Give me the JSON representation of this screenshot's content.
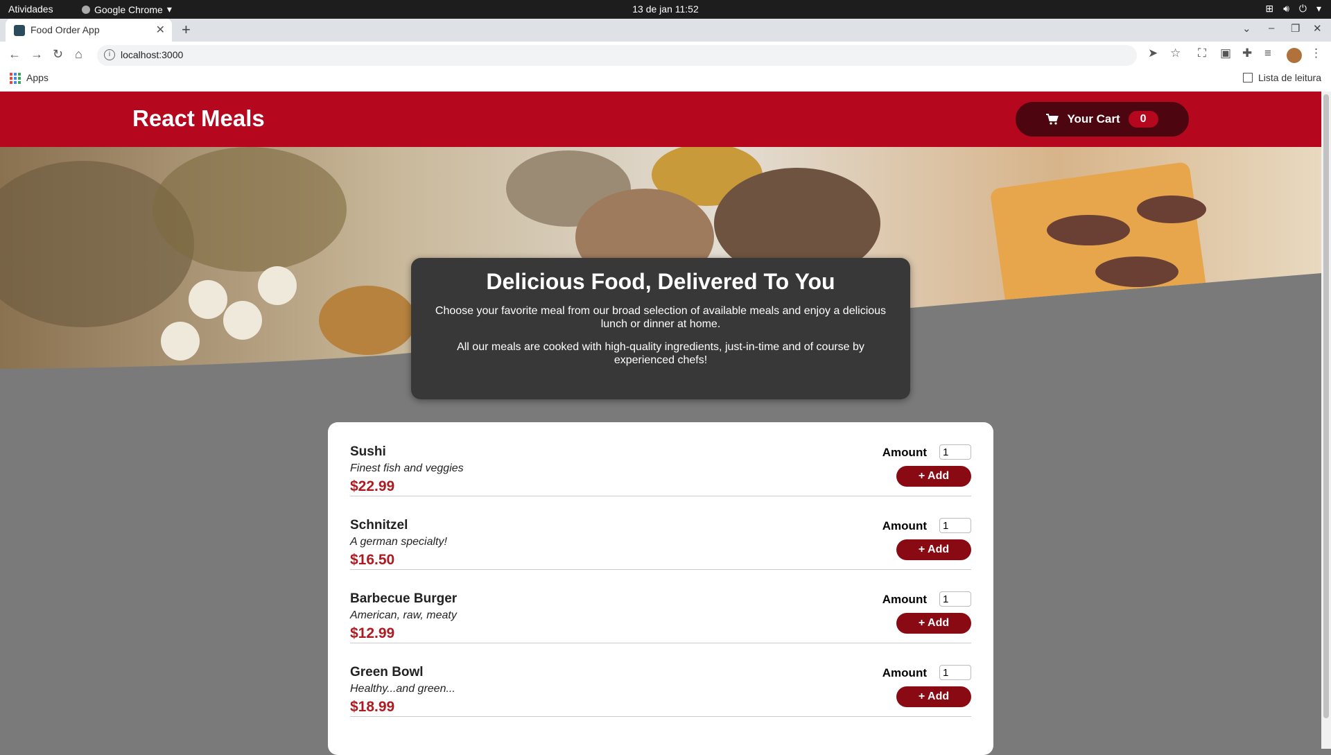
{
  "os": {
    "activities": "Atividades",
    "app_menu": "Google Chrome",
    "clock": "13 de jan  11:52"
  },
  "browser": {
    "tab_title": "Food Order App",
    "url": "localhost:3000",
    "bookmark_apps": "Apps",
    "reading_list": "Lista de leitura"
  },
  "app": {
    "brand": "React Meals",
    "cart_label": "Your Cart",
    "cart_count": "0",
    "accent": "#b5071d"
  },
  "summary": {
    "title": "Delicious Food, Delivered To You",
    "p1": "Choose your favorite meal from our broad selection of available meals and enjoy a delicious lunch or dinner at home.",
    "p2": "All our meals are cooked with high-quality ingredients, just-in-time and of course by experienced chefs!"
  },
  "meals": [
    {
      "name": "Sushi",
      "description": "Finest fish and veggies",
      "price": "$22.99",
      "amount_label": "Amount",
      "amount": "1",
      "add_label": "+ Add"
    },
    {
      "name": "Schnitzel",
      "description": "A german specialty!",
      "price": "$16.50",
      "amount_label": "Amount",
      "amount": "1",
      "add_label": "+ Add"
    },
    {
      "name": "Barbecue Burger",
      "description": "American, raw, meaty",
      "price": "$12.99",
      "amount_label": "Amount",
      "amount": "1",
      "add_label": "+ Add"
    },
    {
      "name": "Green Bowl",
      "description": "Healthy...and green...",
      "price": "$18.99",
      "amount_label": "Amount",
      "amount": "1",
      "add_label": "+ Add"
    }
  ]
}
